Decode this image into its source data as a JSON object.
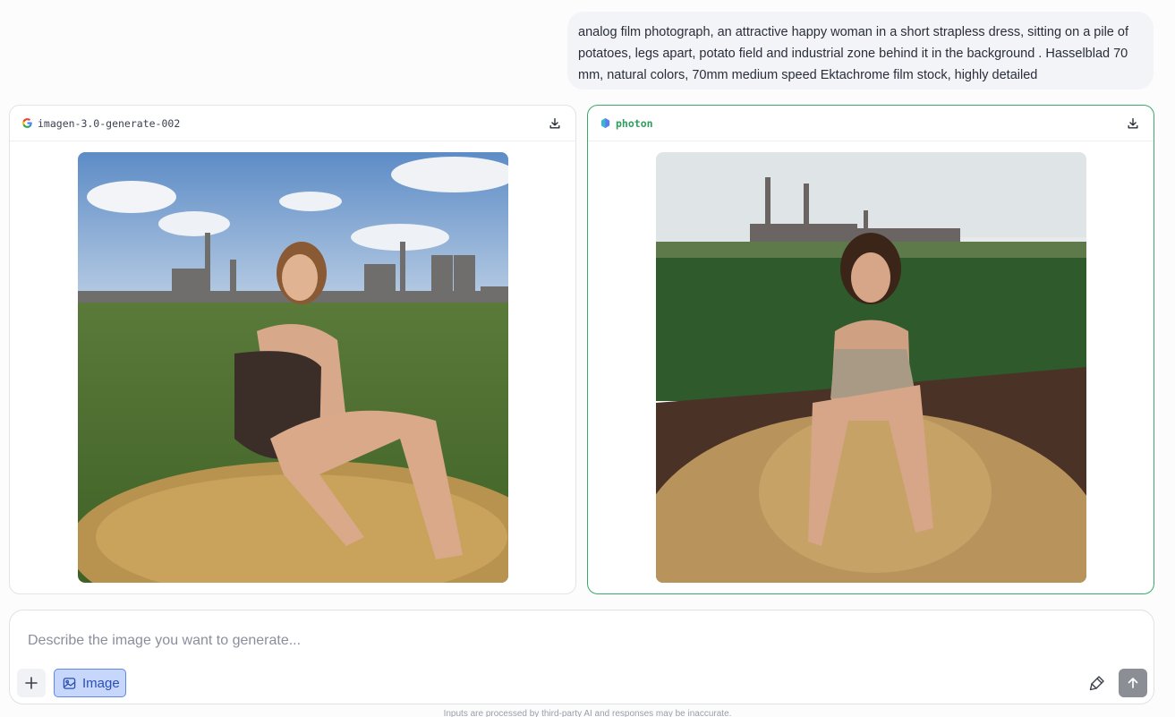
{
  "prompt": {
    "text": "analog film photograph, an attractive happy woman in a short strapless dress, sitting on a pile of potatoes, legs apart, potato field and industrial zone behind it in the background . Hasselblad 70 mm, natural colors, 70mm medium speed Ektachrome film stock, highly detailed"
  },
  "panels": [
    {
      "model": "imagen-3.0-generate-002",
      "icon": "google-g-icon",
      "selected": false
    },
    {
      "model": "photon",
      "icon": "photon-logo-icon",
      "selected": true
    }
  ],
  "composer": {
    "placeholder": "Describe the image you want to generate...",
    "value": "",
    "mode_label": "Image"
  },
  "footer": {
    "disclaimer": "Inputs are processed by third-party AI and responses may be inaccurate."
  },
  "colors": {
    "selected_border": "#3aa86b",
    "chip_bg": "#c7d7fb",
    "chip_border": "#5f86e8",
    "send_bg": "#8b8e95"
  }
}
